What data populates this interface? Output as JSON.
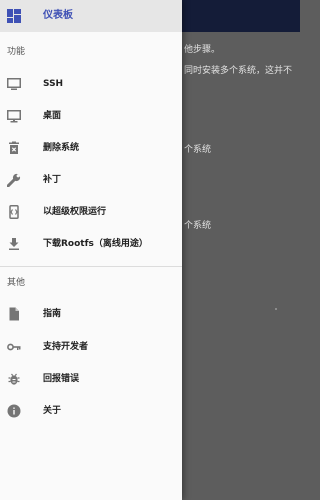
{
  "background": {
    "line1": "他步骤。",
    "line2": "同时安装多个系统，这并不",
    "line3": "个系统",
    "line4": "个系统"
  },
  "drawer": {
    "header_item": {
      "label": "仪表板",
      "icon": "dashboard-icon"
    },
    "sections": [
      {
        "title": "功能",
        "items": [
          {
            "label": "SSH",
            "icon": "monitor-icon"
          },
          {
            "label": "桌面",
            "icon": "desktop-icon"
          },
          {
            "label": "删除系统",
            "icon": "trash-icon"
          },
          {
            "label": "补丁",
            "icon": "wrench-icon"
          },
          {
            "label": "以超级权限运行",
            "icon": "root-phone-icon"
          },
          {
            "label": "下载Rootfs（离线用途）",
            "icon": "download-icon"
          }
        ]
      },
      {
        "title": "其他",
        "items": [
          {
            "label": "指南",
            "icon": "document-icon"
          },
          {
            "label": "支持开发者",
            "icon": "key-icon"
          },
          {
            "label": "回报错误",
            "icon": "bug-icon"
          },
          {
            "label": "关于",
            "icon": "info-icon"
          }
        ]
      }
    ]
  },
  "colors": {
    "accent": "#3f51b5",
    "scrim_appbar": "#141c38",
    "icon_gray": "#757575"
  }
}
